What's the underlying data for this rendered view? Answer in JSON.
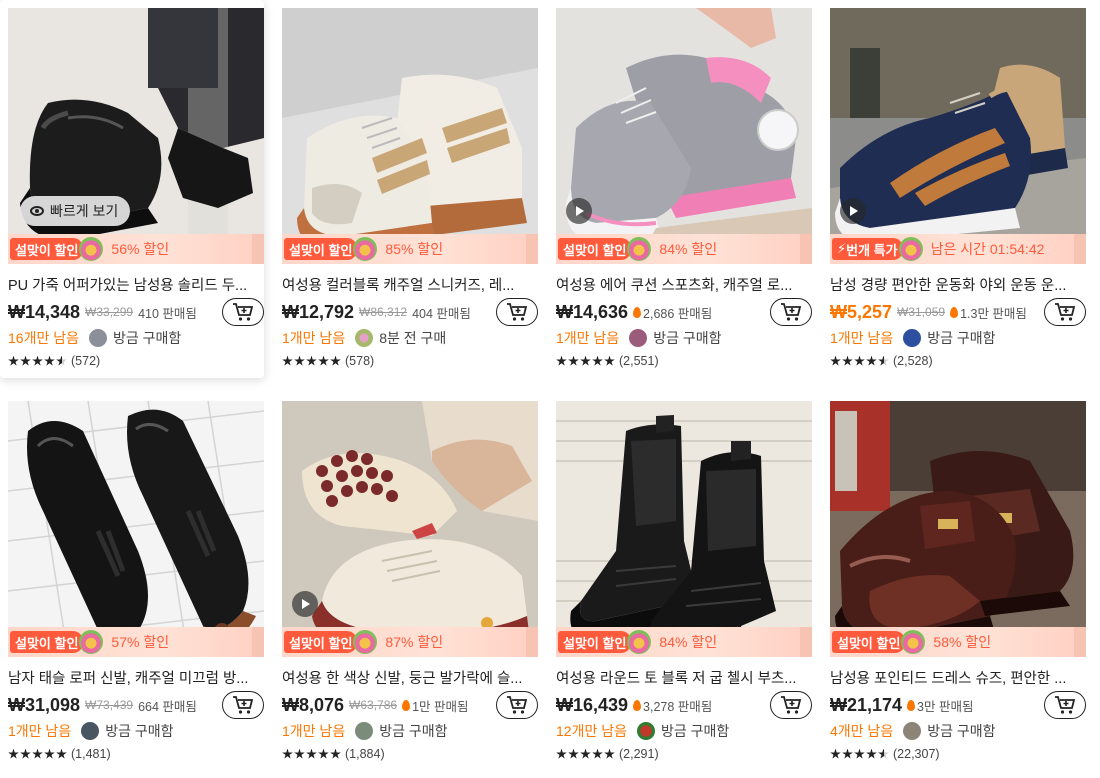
{
  "quick_view_label": "빠르게 보기",
  "products": [
    {
      "promo_tag": "설맞이 할인",
      "promo_text": "56% 할인",
      "title": "PU 가죽 어퍼가있는 남성용 솔리드 두...",
      "price": "₩14,348",
      "original_price": "₩33,299",
      "sold": "410 판매됨",
      "hot": false,
      "stock": "16개만 남음",
      "buyer": "방금 구매함",
      "reviews": "(572)",
      "stars": 4.5,
      "image_icon": "loafer-black-leather",
      "avatar_color": "#8a8f99",
      "hovered": true,
      "video": false,
      "price_orange": false
    },
    {
      "promo_tag": "설맞이 할인",
      "promo_text": "85% 할인",
      "title": "여성용 컬러블록 캐주얼 스니커즈, 레...",
      "price": "₩12,792",
      "original_price": "₩86,312",
      "sold": "404 판매됨",
      "hot": false,
      "stock": "1개만 남음",
      "buyer": "8분 전 구매",
      "reviews": "(578)",
      "stars": 5,
      "image_icon": "sneaker-beige-striped",
      "avatar_color": "#a6b86a",
      "hovered": false,
      "video": false,
      "price_orange": false
    },
    {
      "promo_tag": "설맞이 할인",
      "promo_text": "84% 할인",
      "title": "여성용 에어 쿠션 스포츠화, 캐주얼 로...",
      "price": "₩14,636",
      "original_price": "",
      "sold": "2,686 판매됨",
      "hot": true,
      "stock": "1개만 남음",
      "buyer": "방금 구매함",
      "reviews": "(2,551)",
      "stars": 5,
      "image_icon": "sneaker-grey-pink",
      "avatar_color": "#9a5c7a",
      "hovered": false,
      "video": true,
      "price_orange": false
    },
    {
      "promo_tag": "번개 특가",
      "promo_text": "남은 시간 01:54:42",
      "title": "남성 경량 편안한 운동화 야외 운동 운...",
      "price": "₩5,257",
      "original_price": "₩31,059",
      "sold": "1.3만 판매됨",
      "hot": true,
      "stock": "1개만 남음",
      "buyer": "방금 구매함",
      "reviews": "(2,528)",
      "stars": 4.5,
      "image_icon": "sneaker-navy-brown",
      "avatar_color": "#2c4fa0",
      "hovered": false,
      "video": true,
      "price_orange": true
    },
    {
      "promo_tag": "설맞이 할인",
      "promo_text": "57% 할인",
      "title": "남자 태슬 로퍼 신발, 캐주얼 미끄럼 방...",
      "price": "₩31,098",
      "original_price": "₩73,439",
      "sold": "664 판매됨",
      "hot": false,
      "stock": "1개만 남음",
      "buyer": "방금 구매함",
      "reviews": "(1,481)",
      "stars": 5,
      "image_icon": "tassel-loafer-black",
      "avatar_color": "#4a5562",
      "hovered": false,
      "video": false,
      "price_orange": false
    },
    {
      "promo_tag": "설맞이 할인",
      "promo_text": "87% 할인",
      "title": "여성용 한 색상 신발, 둥근 발가락에 슬...",
      "price": "₩8,076",
      "original_price": "₩63,786",
      "sold": "1만 판매됨",
      "hot": true,
      "stock": "1개만 남음",
      "buyer": "방금 구매함",
      "reviews": "(1,884)",
      "stars": 5,
      "image_icon": "slip-on-beige",
      "avatar_color": "#7c8c7a",
      "hovered": false,
      "video": true,
      "price_orange": false
    },
    {
      "promo_tag": "설맞이 할인",
      "promo_text": "84% 할인",
      "title": "여성용 라운드 토 블록 저 굽 첼시 부츠...",
      "price": "₩16,439",
      "original_price": "",
      "sold": "3,278 판매됨",
      "hot": true,
      "stock": "12개만 남음",
      "buyer": "방금 구매함",
      "reviews": "(2,291)",
      "stars": 5,
      "image_icon": "chelsea-boot-black",
      "avatar_color": "#c0392b",
      "hovered": false,
      "video": false,
      "price_orange": false
    },
    {
      "promo_tag": "설맞이 할인",
      "promo_text": "58% 할인",
      "title": "남성용 포인티드 드레스 슈즈, 편안한 ...",
      "price": "₩21,174",
      "original_price": "",
      "sold": "3만 판매됨",
      "hot": true,
      "stock": "4개만 남음",
      "buyer": "방금 구매함",
      "reviews": "(22,307)",
      "stars": 4.5,
      "image_icon": "dress-shoe-brown",
      "avatar_color": "#8d8478",
      "hovered": false,
      "video": false,
      "price_orange": false
    }
  ]
}
